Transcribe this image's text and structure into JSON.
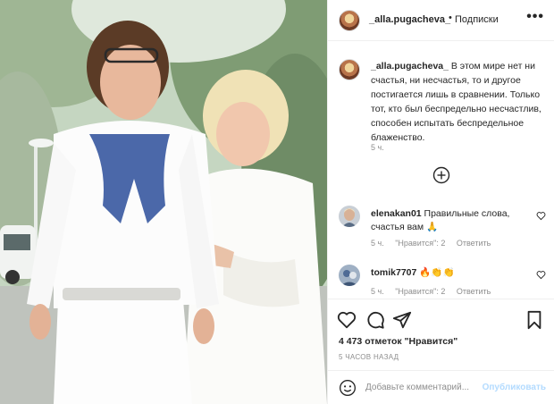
{
  "header": {
    "username": "_alla.pugacheva_",
    "separator": "•",
    "follow_status": "Подписки",
    "more": "•••"
  },
  "caption": {
    "username": "_alla.pugacheva_",
    "text": "В этом мире нет ни счастья, ни несчастья, то и другое постигается лишь в сравнении. Только тот, кто был беспредельно несчастлив, способен испытать беспредельное блаженство.",
    "time": "5 ч."
  },
  "comments": [
    {
      "username": "elenakan01",
      "text": "Правильные слова, счастья вам 🙏",
      "time": "5 ч.",
      "likes": "\"Нравится\": 2",
      "reply": "Ответить"
    },
    {
      "username": "tomik7707",
      "text": "🔥👏👏",
      "time": "5 ч.",
      "likes": "\"Нравится\": 2",
      "reply": "Ответить"
    }
  ],
  "post": {
    "likes": "4 473 отметок \"Нравится\"",
    "posted": "5 ЧАСОВ НАЗАД"
  },
  "add_comment": {
    "placeholder": "Добавьте комментарий...",
    "post_label": "Опубликовать"
  },
  "icons": {
    "more": "more-icon",
    "load_more": "plus-circle-icon",
    "like": "heart-icon",
    "comment": "comment-icon",
    "share": "send-icon",
    "save": "bookmark-icon",
    "emoji": "emoji-icon"
  },
  "colors": {
    "link_disabled": "#b3dbff",
    "secondary_text": "#8e8e8e",
    "primary_text": "#262626",
    "border": "#efefef"
  }
}
